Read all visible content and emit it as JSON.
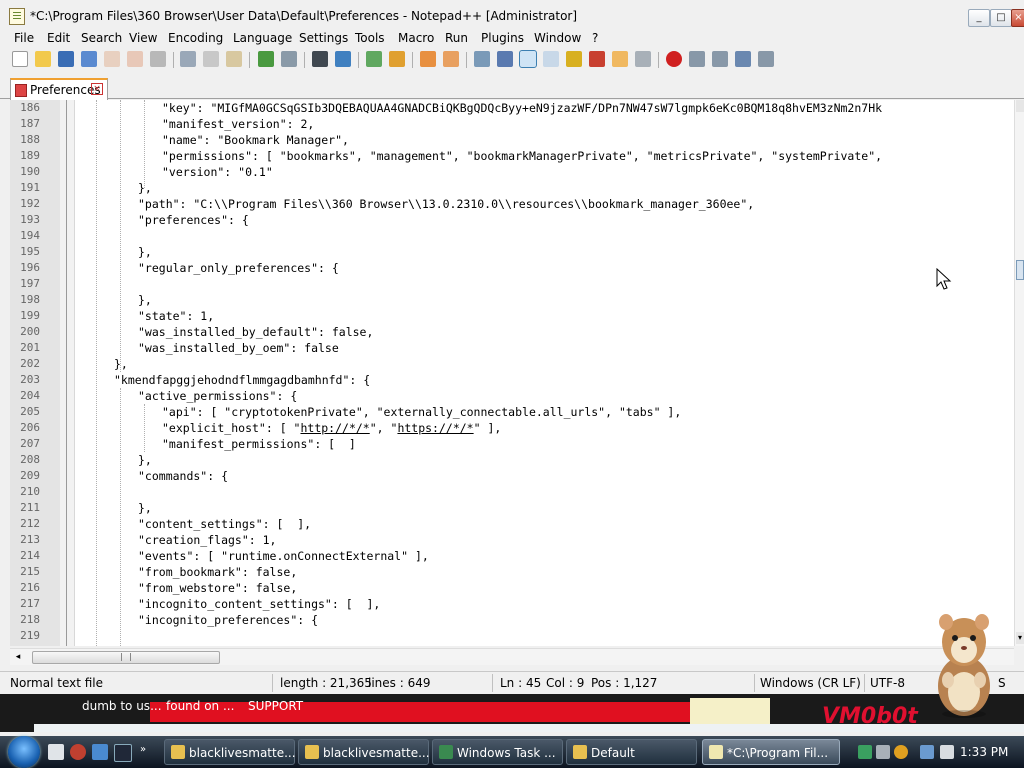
{
  "window": {
    "title": "*C:\\Program Files\\360 Browser\\User Data\\Default\\Preferences - Notepad++ [Administrator]",
    "minimize": "_",
    "maximize": "□",
    "close": "×"
  },
  "menu": [
    "File",
    "Edit",
    "Search",
    "View",
    "Encoding",
    "Language",
    "Settings",
    "Tools",
    "Macro",
    "Run",
    "Plugins",
    "Window",
    "?"
  ],
  "toolbar_icons": [
    "new-file-icon",
    "open-file-icon",
    "save-icon",
    "save-all-icon",
    "close-icon",
    "close-all-icon",
    "print-icon",
    "cut-icon",
    "copy-icon",
    "paste-icon",
    "undo-icon",
    "redo-icon",
    "find-icon",
    "replace-icon",
    "zoom-in-icon",
    "zoom-out-icon",
    "sync-vertical-icon",
    "sync-horizontal-icon",
    "word-wrap-icon",
    "show-all-chars-icon",
    "indent-guide-icon",
    "udl-icon",
    "doc-map-icon",
    "function-list-icon",
    "folder-workspace-icon",
    "monitoring-icon",
    "record-macro-icon",
    "stop-record-icon",
    "play-macro-icon",
    "run-macro-multiple-icon",
    "save-macro-icon"
  ],
  "tab": {
    "label": "Preferences",
    "close": "×"
  },
  "lines": [
    {
      "n": "186",
      "indent": 3,
      "text": "\"key\": \"MIGfMA0GCSqGSIb3DQEBAQUAA4GNADCBiQKBgQDQcByy+eN9jzazWF/DPn7NW47sW7lgmpk6eKc0BQM18q8hvEM3zNm2n7Hk"
    },
    {
      "n": "187",
      "indent": 3,
      "text": "\"manifest_version\": 2,"
    },
    {
      "n": "188",
      "indent": 3,
      "text": "\"name\": \"Bookmark Manager\","
    },
    {
      "n": "189",
      "indent": 3,
      "text": "\"permissions\": [ \"bookmarks\", \"management\", \"bookmarkManagerPrivate\", \"metricsPrivate\", \"systemPrivate\","
    },
    {
      "n": "190",
      "indent": 3,
      "text": "\"version\": \"0.1\""
    },
    {
      "n": "191",
      "indent": 2,
      "text": "},"
    },
    {
      "n": "192",
      "indent": 2,
      "text": "\"path\": \"C:\\\\Program Files\\\\360 Browser\\\\13.0.2310.0\\\\resources\\\\bookmark_manager_360ee\","
    },
    {
      "n": "193",
      "indent": 2,
      "text": "\"preferences\": {"
    },
    {
      "n": "194",
      "indent": 2,
      "text": ""
    },
    {
      "n": "195",
      "indent": 2,
      "text": "},"
    },
    {
      "n": "196",
      "indent": 2,
      "text": "\"regular_only_preferences\": {"
    },
    {
      "n": "197",
      "indent": 2,
      "text": ""
    },
    {
      "n": "198",
      "indent": 2,
      "text": "},"
    },
    {
      "n": "199",
      "indent": 2,
      "text": "\"state\": 1,"
    },
    {
      "n": "200",
      "indent": 2,
      "text": "\"was_installed_by_default\": false,"
    },
    {
      "n": "201",
      "indent": 2,
      "text": "\"was_installed_by_oem\": false"
    },
    {
      "n": "202",
      "indent": 1,
      "text": "},"
    },
    {
      "n": "203",
      "indent": 1,
      "text": "\"kmendfapggjehodndflmmgagdbamhnfd\": {"
    },
    {
      "n": "204",
      "indent": 2,
      "text": "\"active_permissions\": {"
    },
    {
      "n": "205",
      "indent": 3,
      "text": "\"api\": [ \"cryptotokenPrivate\", \"externally_connectable.all_urls\", \"tabs\" ],"
    },
    {
      "n": "206",
      "indent": 3,
      "text": "\"explicit_host\": [ \"",
      "url1": "http://*/*",
      "mid": "\", \"",
      "url2": "https://*/*",
      "tail": "\" ],"
    },
    {
      "n": "207",
      "indent": 3,
      "text": "\"manifest_permissions\": [  ]"
    },
    {
      "n": "208",
      "indent": 2,
      "text": "},"
    },
    {
      "n": "209",
      "indent": 2,
      "text": "\"commands\": {"
    },
    {
      "n": "210",
      "indent": 2,
      "text": ""
    },
    {
      "n": "211",
      "indent": 2,
      "text": "},"
    },
    {
      "n": "212",
      "indent": 2,
      "text": "\"content_settings\": [  ],"
    },
    {
      "n": "213",
      "indent": 2,
      "text": "\"creation_flags\": 1,"
    },
    {
      "n": "214",
      "indent": 2,
      "text": "\"events\": [ \"runtime.onConnectExternal\" ],"
    },
    {
      "n": "215",
      "indent": 2,
      "text": "\"from_bookmark\": false,"
    },
    {
      "n": "216",
      "indent": 2,
      "text": "\"from_webstore\": false,"
    },
    {
      "n": "217",
      "indent": 2,
      "text": "\"incognito_content_settings\": [  ],"
    },
    {
      "n": "218",
      "indent": 2,
      "text": "\"incognito_preferences\": {"
    },
    {
      "n": "219",
      "indent": 2,
      "text": ""
    }
  ],
  "hscroll_grip": "|||",
  "status": {
    "file_type": "Normal text file",
    "length": "length : 21,365",
    "lines": "lines : 649",
    "ln": "Ln : 45",
    "col": "Col : 9",
    "pos": "Pos : 1,127",
    "eol": "Windows (CR LF)",
    "encoding": "UTF-8",
    "ins": "S"
  },
  "background_strip": {
    "text1": "dumb to us...",
    "text2": "found on ...",
    "text3": "SUPPORT",
    "logo": "VM0b0t"
  },
  "taskbar": {
    "tasks": [
      {
        "label": "blacklivesmatte...",
        "icon": "folder-icon"
      },
      {
        "label": "blacklivesmatte...",
        "icon": "folder-icon"
      },
      {
        "label": "Windows Task ...",
        "icon": "task-manager-icon"
      },
      {
        "label": "Default",
        "icon": "folder-icon"
      },
      {
        "label": "*C:\\Program Fil...",
        "icon": "notepadpp-icon"
      }
    ],
    "clock": "1:33 PM"
  },
  "colors": {
    "accent_tab": "#f0a030",
    "editor_bg": "#ffffff",
    "gutter_bg": "#e4e4e4",
    "taskbar_top": "#3c4a58"
  }
}
